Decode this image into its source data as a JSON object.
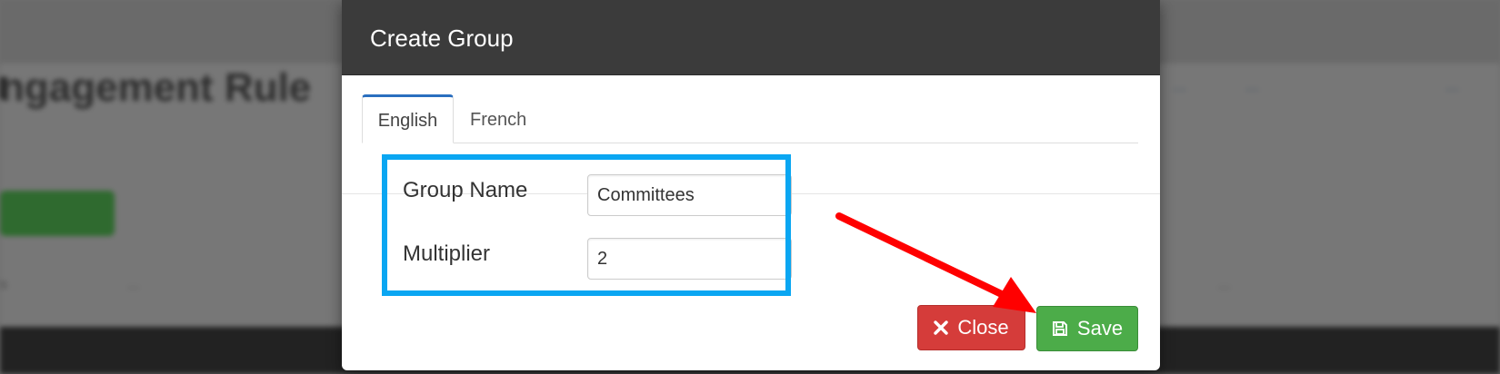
{
  "background": {
    "heading": "ngagement Rule",
    "right_links": [
      "...",
      "...",
      "..."
    ],
    "left_partial": "s",
    "column_text": "..."
  },
  "modal": {
    "title": "Create Group",
    "tabs": [
      {
        "label": "English",
        "active": true
      },
      {
        "label": "French",
        "active": false
      }
    ],
    "fields": {
      "group_name": {
        "label": "Group Name",
        "value": "Committees"
      },
      "multiplier": {
        "label": "Multiplier",
        "value": "2"
      }
    },
    "buttons": {
      "close": {
        "label": "Close",
        "icon": "x-icon",
        "color": "#d53c3a"
      },
      "save": {
        "label": "Save",
        "icon": "floppy-disk-icon",
        "color": "#4cac49"
      }
    }
  },
  "annotations": {
    "highlight_color": "#0aa6f2",
    "arrow_color": "#ff0000"
  }
}
